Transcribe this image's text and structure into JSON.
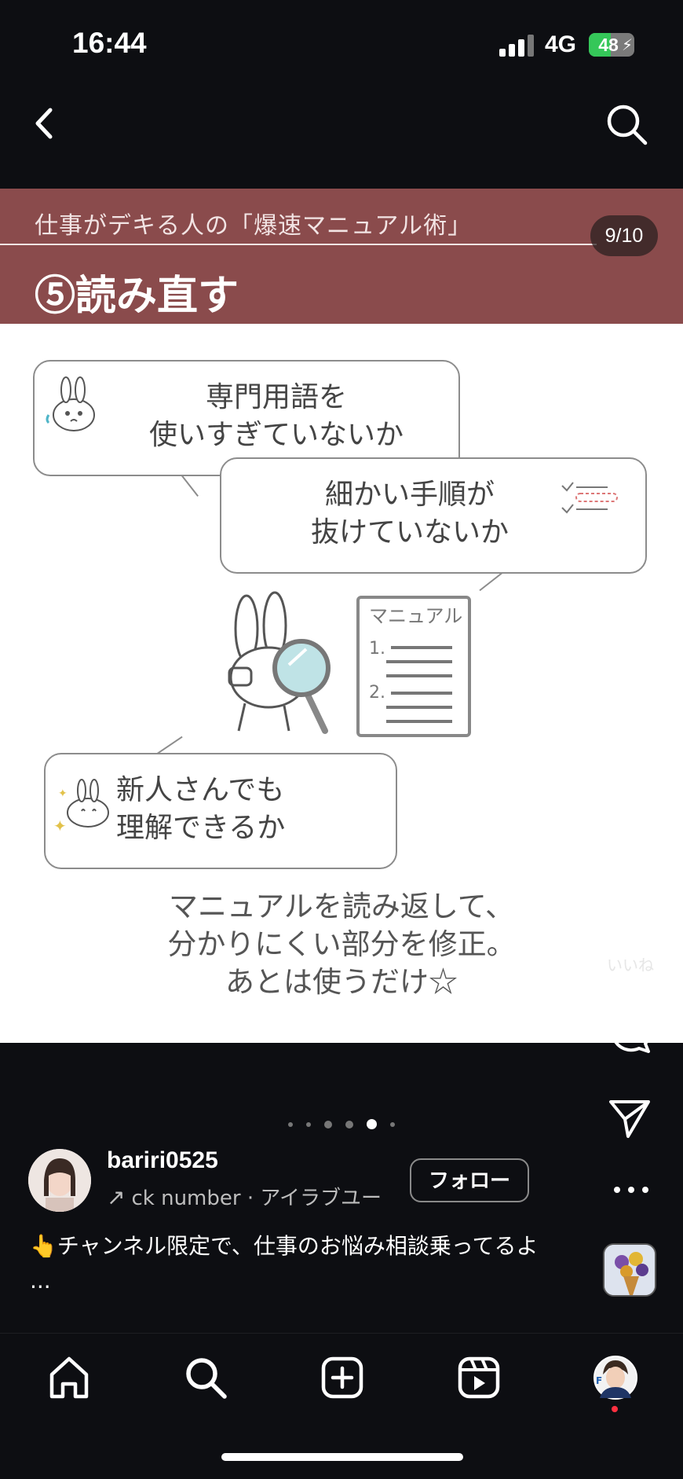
{
  "status_bar": {
    "time": "16:44",
    "network": "4G",
    "battery_level": "48",
    "battery_fraction": 0.48
  },
  "top_nav": {
    "back_icon": "chevron-left-icon",
    "search_icon": "search-icon"
  },
  "post": {
    "subtitle": "仕事がデキる人の「爆速マニュアル術」",
    "page_indicator": "9/10",
    "step_title": "⑤読み直す",
    "bubbles": [
      {
        "line1": "専門用語を",
        "line2": "使いすぎていないか"
      },
      {
        "line1": "細かい手順が",
        "line2": "抜けていないか"
      },
      {
        "line1": "新人さんでも",
        "line2": "理解できるか"
      }
    ],
    "manual_label": "マニュアル",
    "manual_items": [
      "1.",
      "2."
    ],
    "caption": [
      "マニュアルを読み返して、",
      "分かりにくい部分を修正。",
      "あとは使うだけ☆"
    ]
  },
  "actions": {
    "like_label": "いいね",
    "like_icon": "heart-icon",
    "comment_icon": "comment-icon",
    "share_icon": "send-icon",
    "more_icon": "more-icon"
  },
  "carousel": {
    "total_visible_dots": 6,
    "active_index": 4
  },
  "author": {
    "username": "bariri0525",
    "music": "ck number · アイラブユー",
    "follow_label": "フォロー"
  },
  "post_caption": "👆チャンネル限定で、仕事のお悩み相談乗ってるよ ...",
  "bottom_nav": [
    "home-icon",
    "search-icon",
    "create-icon",
    "reels-icon",
    "profile-avatar"
  ]
}
